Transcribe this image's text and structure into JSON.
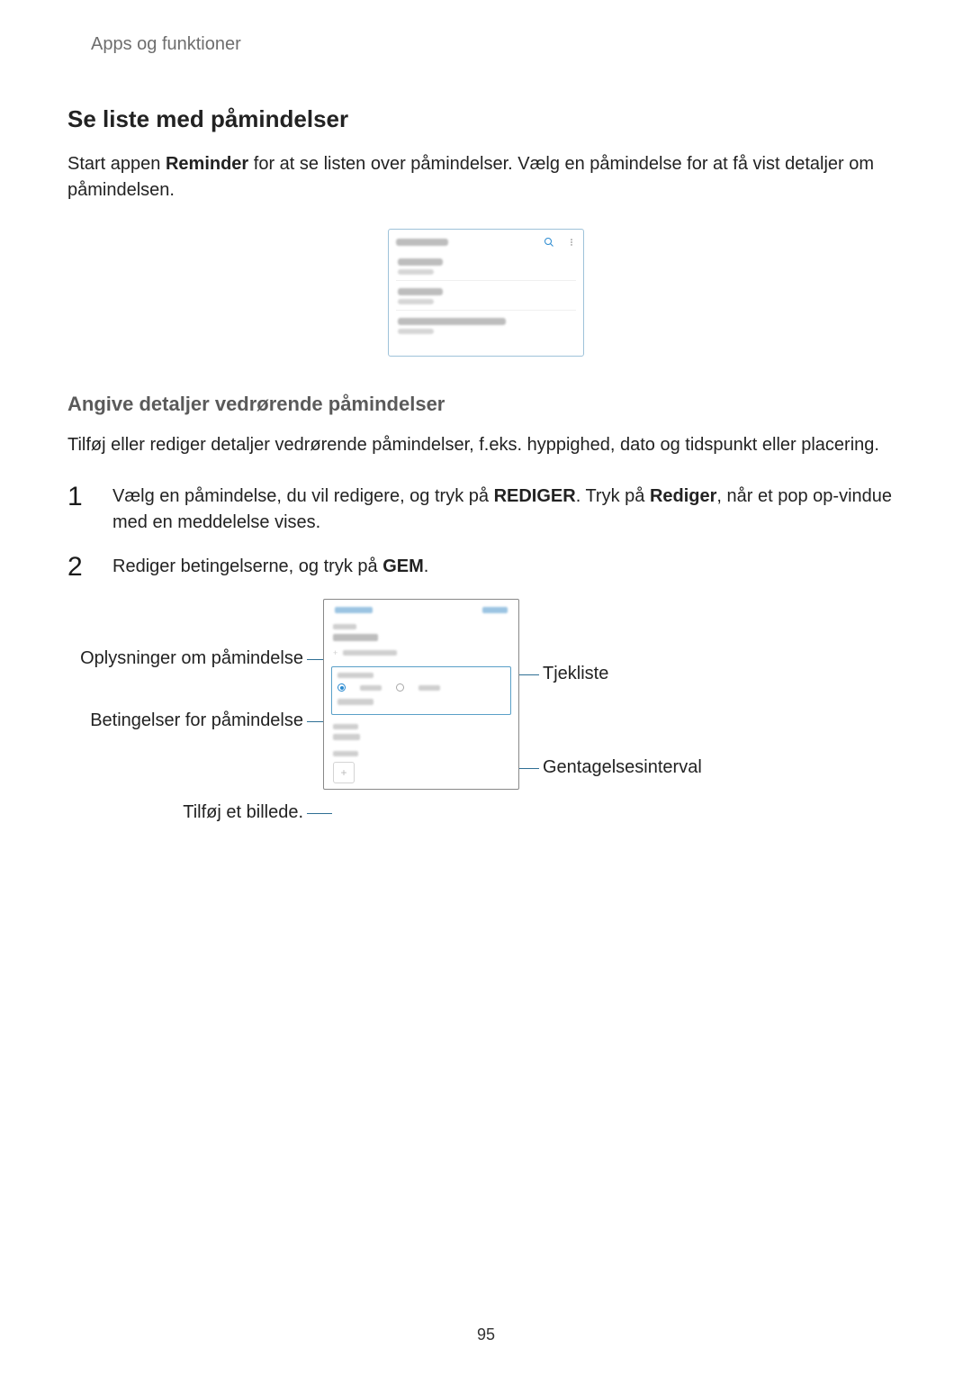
{
  "header": {
    "breadcrumb": "Apps og funktioner"
  },
  "section1": {
    "title": "Se liste med påmindelser",
    "paragraph_pre": "Start appen ",
    "paragraph_bold": "Reminder",
    "paragraph_post": " for at se listen over påmindelser. Vælg en påmindelse for at få vist detaljer om påmindelsen."
  },
  "section2": {
    "title": "Angive detaljer vedrørende påmindelser",
    "paragraph": "Tilføj eller rediger detaljer vedrørende påmindelser, f.eks. hyppighed, dato og tidspunkt eller placering."
  },
  "steps": {
    "s1_num": "1",
    "s1_pre": "Vælg en påmindelse, du vil redigere, og tryk på ",
    "s1_b1": "REDIGER",
    "s1_mid": ". Tryk på ",
    "s1_b2": "Rediger",
    "s1_post": ", når et pop op-vindue med en meddelelse vises.",
    "s2_num": "2",
    "s2_pre": "Rediger betingelserne, og tryk på ",
    "s2_b1": "GEM",
    "s2_post": "."
  },
  "callouts": {
    "info": "Oplysninger om påmindelse",
    "conditions": "Betingelser for påmindelse",
    "add_image": "Tilføj et billede.",
    "checklist": "Tjekliste",
    "repeat": "Gentagelsesinterval"
  },
  "footer": {
    "page_number": "95"
  }
}
